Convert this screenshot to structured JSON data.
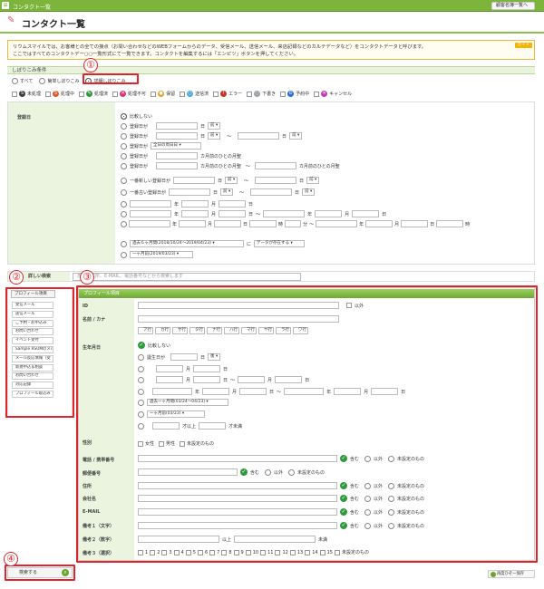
{
  "window": {
    "title": "コンタクト一覧",
    "top_button": "顧客名簿一覧へ"
  },
  "page": {
    "title": "コンタクト一覧"
  },
  "notice": {
    "line1": "リウムスマイルでは、お客様との全ての接点（お問い合わせなどのWEBフォームからのデータ、受信メール、送信メール、来店記録などのカルテデータなど）をコンタクトデータと呼びます。",
    "line2": "ここではすべてのコンタクトデー○○一覧形式にて一覧できます。コンタクトを編集するには「エンピツ」ボタンを押してください。",
    "guide": "ガイド"
  },
  "filter": {
    "section_title": "しぼりこみ条件",
    "modes": [
      "すべて",
      "簡単しぼりこみ",
      "詳細しぼりこみ"
    ],
    "statuses": [
      {
        "label": "未処理",
        "icon": "S",
        "color": "#3d3d3d"
      },
      {
        "label": "処理中",
        "icon": "S",
        "color": "#e05a2c"
      },
      {
        "label": "処理済",
        "icon": "✎",
        "color": "#2e9a3a"
      },
      {
        "label": "処理不可",
        "icon": "✕",
        "color": "#d9367a"
      },
      {
        "label": "保留",
        "icon": "●",
        "color": "#e0a020"
      },
      {
        "label": "送信済",
        "icon": "○",
        "color": "#4aa8d8"
      },
      {
        "label": "エラー",
        "icon": "!",
        "color": "#c0392b"
      },
      {
        "label": "下書き",
        "icon": "◌",
        "color": "#9aa0a6"
      },
      {
        "label": "予約中",
        "icon": "⏲",
        "color": "#2b6cd6"
      },
      {
        "label": "キャンセル",
        "icon": "✕",
        "color": "#c23fb0"
      }
    ],
    "date_label": "登録日",
    "date_options": {
      "nolimit": "比較しない",
      "reg": "登録日が",
      "day": "日",
      "before": "前",
      "tilde": "〜",
      "reg_type": "登録日が",
      "reg_type_val": "全日の周日日",
      "months_ago": "カ月前のひとの月聖",
      "latest": "一番新しい登録日が",
      "oldest": "一番古い登録日が",
      "year": "年",
      "month": "月",
      "hour": "時",
      "minute": "分",
      "recent6": "過去６ヶ月間(2018/10/24〜2019/04/23)",
      "recent6_extra": "データが存在する",
      "recent_cond": "に",
      "month_ago": "一ヶ月前(2019/03/23)"
    }
  },
  "search": {
    "label": "詳しい検索",
    "placeholder": "氏名、住所、E-MAIL、電話番号などから検索します",
    "button": "検索する"
  },
  "sidebar": {
    "title": "プロフィール項目",
    "items": [
      "受信メール",
      "送信メール",
      "ご予約・お申込み",
      "お問い合わせ",
      "イベント受付",
      "Sample RSUMのメル",
      "メール反応情報（受",
      "新規申込＆相談",
      "お問い合わせ",
      "対応記録",
      "プロフィール取込み"
    ]
  },
  "profile": {
    "title": "プロフィール項目",
    "fields": {
      "id": "ID",
      "name": "名前 / カナ",
      "birthday": "生年月日",
      "gender": "性別",
      "phone": "電話 / 携帯番号",
      "zip": "郵便番号",
      "address": "住所",
      "company": "会社名",
      "email": "E-MAIL",
      "memo1": "備考１（文字）",
      "memo2": "備考２（数字）",
      "memo3": "備考３（選択）"
    },
    "kana": [
      "ア行",
      "カ行",
      "サ行",
      "タ行",
      "ナ行",
      "ハ行",
      "マ行",
      "ヤ行",
      "ラ行",
      "ワ行"
    ],
    "birthday_opts": {
      "nolimit": "比較しない",
      "birth": "誕生日が",
      "later": "後",
      "month": "月",
      "day": "日",
      "year": "年",
      "hour": "時",
      "minute": "分",
      "recent": "過去一ヶ月間(03/24〜04/23)",
      "month_ago": "一ヶ月前(03/23)",
      "age_min": "才以上",
      "age_max": "才未満"
    },
    "gender_opts": [
      "女性",
      "男性",
      "未設定のもの"
    ],
    "contain": "含む",
    "other": "以外",
    "unset": "未設定のもの",
    "id_other": "以外",
    "memo2_min": "以上",
    "memo2_max": "未満",
    "memo3_options": [
      "1",
      "2",
      "3",
      "4",
      "5",
      "6",
      "7",
      "8",
      "9",
      "10",
      "11",
      "12",
      "13",
      "14",
      "15"
    ],
    "memo3_unset": "未設定のもの"
  },
  "footer": {
    "save_button": "再度ひぞー保存"
  },
  "annotations": [
    "①",
    "②",
    "③",
    "④"
  ]
}
